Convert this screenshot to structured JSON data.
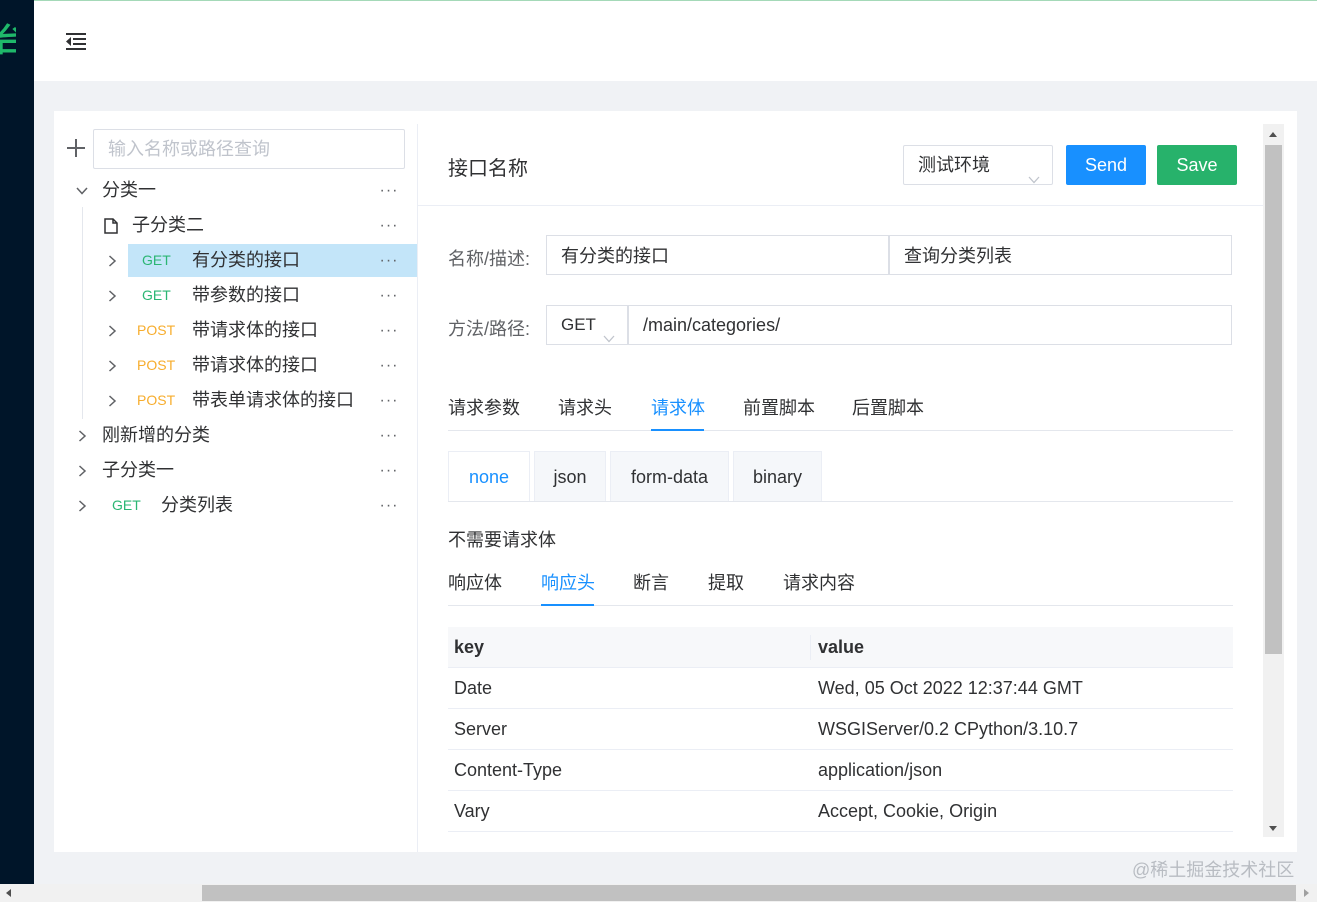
{
  "sidebar": {
    "logo_fragment": "台"
  },
  "tree": {
    "search_placeholder": "输入名称或路径查询",
    "more_label": "···",
    "nodes": [
      {
        "label": "分类一",
        "method": ""
      },
      {
        "label": "子分类二",
        "method": ""
      },
      {
        "label": "有分类的接口",
        "method": "GET"
      },
      {
        "label": "带参数的接口",
        "method": "GET"
      },
      {
        "label": "带请求体的接口",
        "method": "POST"
      },
      {
        "label": "带请求体的接口",
        "method": "POST"
      },
      {
        "label": "带表单请求体的接口",
        "method": "POST"
      },
      {
        "label": "刚新增的分类",
        "method": ""
      },
      {
        "label": "子分类一",
        "method": ""
      },
      {
        "label": "分类列表",
        "method": "GET"
      }
    ]
  },
  "panel": {
    "title": "接口名称",
    "env": "测试环境",
    "send_label": "Send",
    "save_label": "Save",
    "name_label": "名称/描述:",
    "name_value": "有分类的接口",
    "desc_value": "查询分类列表",
    "path_label": "方法/路径:",
    "method_value": "GET",
    "path_value": "/main/categories/",
    "request_tabs": [
      "请求参数",
      "请求头",
      "请求体",
      "前置脚本",
      "后置脚本"
    ],
    "body_types": [
      "none",
      "json",
      "form-data",
      "binary"
    ],
    "no_body_text": "不需要请求体",
    "response_tabs": [
      "响应体",
      "响应头",
      "断言",
      "提取",
      "请求内容"
    ]
  },
  "response_headers": {
    "columns": [
      "key",
      "value"
    ],
    "rows": [
      [
        "Date",
        "Wed, 05 Oct 2022 12:37:44 GMT"
      ],
      [
        "Server",
        "WSGIServer/0.2 CPython/3.10.7"
      ],
      [
        "Content-Type",
        "application/json"
      ],
      [
        "Vary",
        "Accept, Cookie, Origin"
      ]
    ]
  },
  "watermark": "@稀土掘金技术社区",
  "colors": {
    "accent": "#1890ff",
    "save": "#27b26b",
    "get": "#2bb673",
    "post": "#f7ad2d",
    "active_row": "#c3e5f9"
  }
}
